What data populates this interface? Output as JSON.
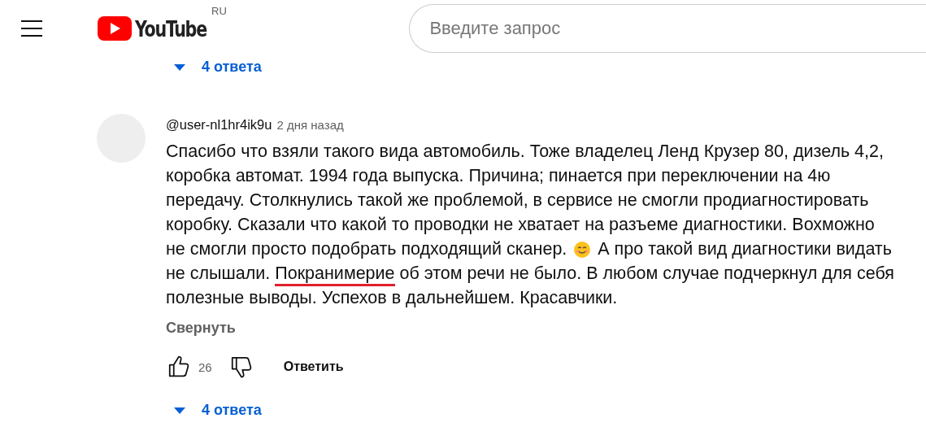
{
  "header": {
    "logo": "YouTube",
    "country": "RU",
    "search": {
      "placeholder": "Введите запрос"
    }
  },
  "replies_toggle_top": {
    "label": "4 ответа",
    "expanded": false
  },
  "comment": {
    "author": "@user-nl1hr4ik9u",
    "time": "2 дня назад",
    "lines": [
      [
        {
          "text": "Спасибо что взяли такого вида автомобиль. Тоже владелец Ленд Крузер 80, дизель 4,2,"
        }
      ],
      [
        {
          "text": "коробка автомат. 1994 года выпуска. Причина; пинается при переключении на 4ю"
        }
      ],
      [
        {
          "text": "передачу. Столкнулись такой же проблемой, в сервисе не смогли продиагностировать"
        }
      ],
      [
        {
          "text": "коробку.  Сказали что какой то проводки не хватает на разъеме диагностики. Вохможно"
        }
      ],
      [
        {
          "text": "не смогли просто подобрать подходящий сканер. "
        },
        {
          "kind": "emoji"
        },
        {
          "text": " А про такой вид диагностики видать"
        }
      ],
      [
        {
          "text": "не слышали. "
        },
        {
          "text": "Покранимерие",
          "underlined": true
        },
        {
          "text": " об этом речи не было. В любом случае подчеркнул для себя"
        }
      ],
      [
        {
          "text": "полезные выводы. Успехов в дальнейшем. Красавчики."
        }
      ]
    ],
    "collapse": "Свернуть",
    "likes": "26",
    "liked": false,
    "disliked": false,
    "reply": "Ответить"
  },
  "replies_toggle": {
    "label": "4 ответа",
    "expanded": false
  }
}
